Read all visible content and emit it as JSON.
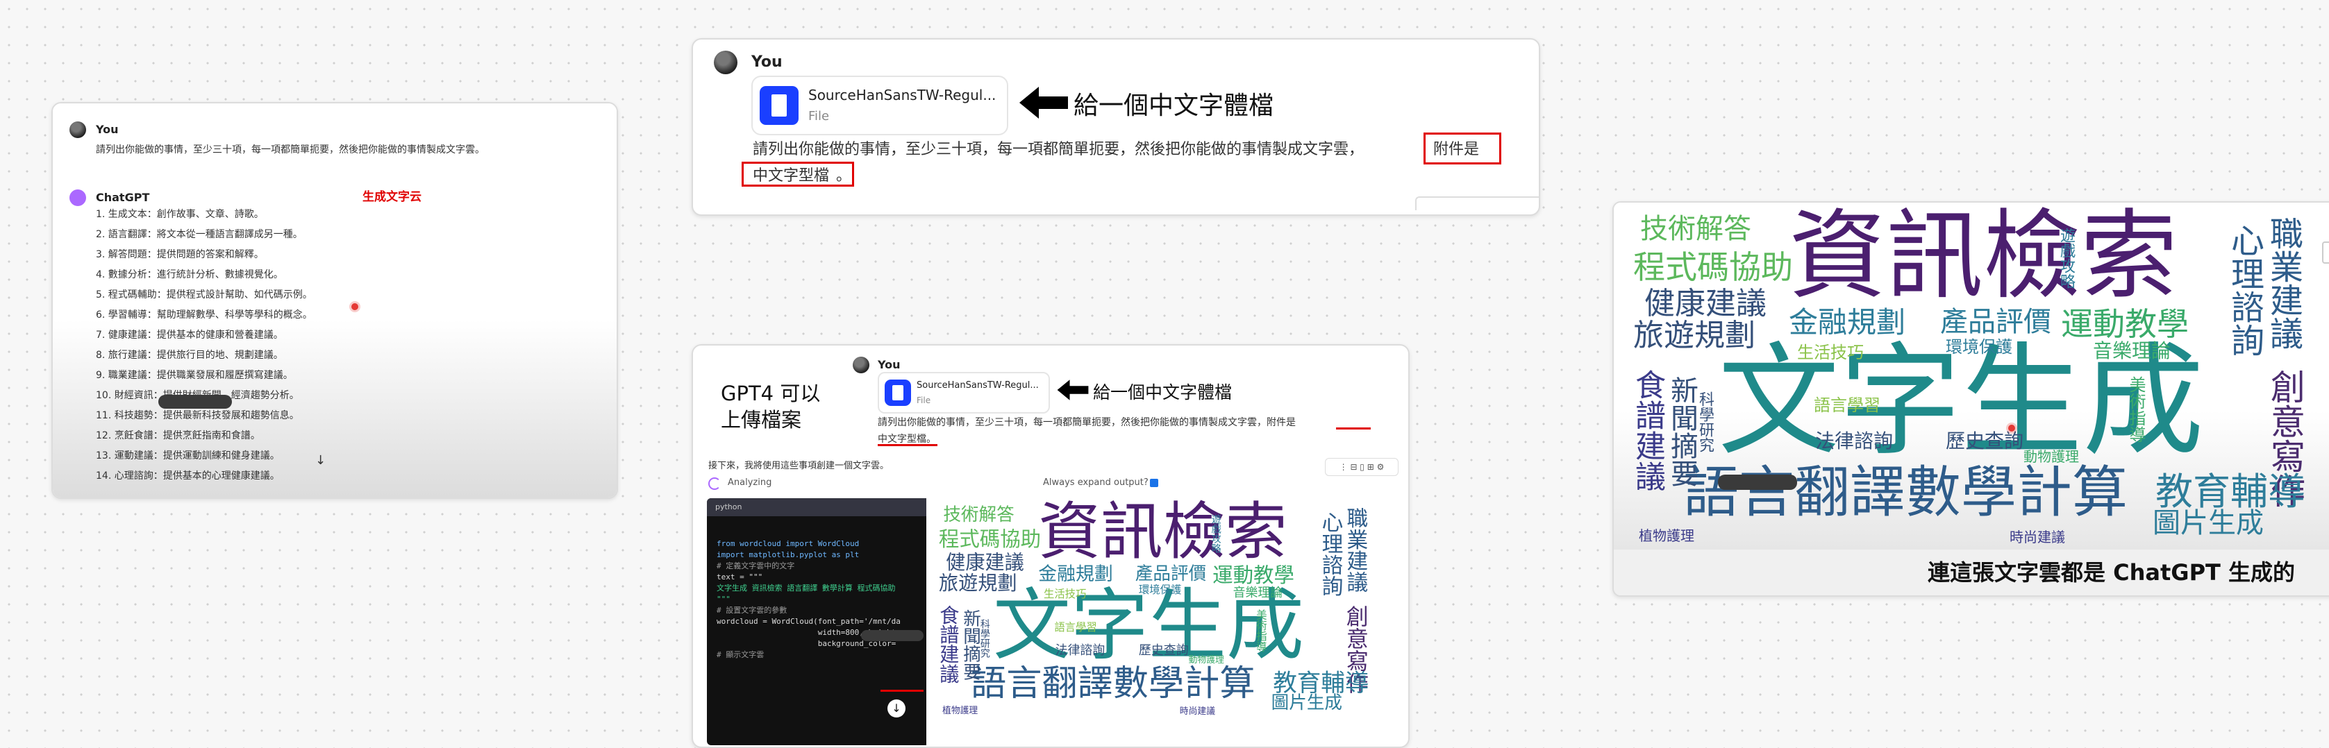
{
  "card1": {
    "user_name": "You",
    "user_prompt": "請列出你能做的事情，至少三十項，每一項都簡單扼要，然後把你能做的事情製成文字雲。",
    "assistant_name": "ChatGPT",
    "red_label": "生成文字云",
    "items": [
      "1. 生成文本：創作故事、文章、詩歌。",
      "2. 語言翻譯：將文本從一種語言翻譯成另一種。",
      "3. 解答問題：提供問題的答案和解釋。",
      "4. 數據分析：進行統計分析、數據視覺化。",
      "5. 程式碼輔助：提供程式設計幫助、如代碼示例。",
      "6. 學習輔導：幫助理解數學、科學等學科的概念。",
      "7. 健康建議：提供基本的健康和營養建議。",
      "8. 旅行建議：提供旅行目的地、規劃建議。",
      "9. 職業建議：提供職業發展和履歷撰寫建議。",
      "10. 財經資訊：提供財經新聞、經濟趨勢分析。",
      "11. 科技趨勢：提供最新科技發展和趨勢信息。",
      "12. 烹飪食譜：提供烹飪指南和食譜。",
      "13. 運動建議：提供運動訓練和健身建議。",
      "14. 心理諮詢：提供基本的心理健康建議。"
    ]
  },
  "card2": {
    "user_name": "You",
    "file_name": "SourceHanSansTW-Regul...",
    "file_type": "File",
    "annotation": "給一個中文字體檔",
    "prompt_line1": "請列出你能做的事情，至少三十項，每一項都簡單扼要，然後把你能做的事情製成文字雲，",
    "prompt_highlight1": "附件是",
    "prompt_highlight2": "中文字型檔",
    "prompt_end": "。"
  },
  "card3": {
    "title_line1": "GPT4 可以",
    "title_line2": "上傳檔案",
    "user_name": "You",
    "file_name": "SourceHanSansTW-Regul...",
    "file_type": "File",
    "annotation": "給一個中文字體檔",
    "prompt_line1": "請列出你能做的事情，至少三十項，每一項都簡單扼要，然後把你能做的事情製成文字雲，附件是",
    "prompt_line2": "中文字型檔。",
    "reply_text": "接下來，我將使用這些事項創建一個文字雲。",
    "analyzing_label": "Analyzing",
    "expand_label": "Always expand output?",
    "code_lang": "python",
    "code_lines": [
      "from wordcloud import WordCloud",
      "import matplotlib.pyplot as plt",
      "",
      "# 定義文字雲中的文字",
      "text = \"\"\"",
      "文字生成 資訊檢索 語言翻譯 數學計算 程式碼協助",
      "\"\"\"",
      "",
      "# 設置文字雲的參數",
      "wordcloud = WordCloud(font_path='/mnt/da",
      "                      width=800, height",
      "                      background_color=",
      "",
      "# 顯示文字雲"
    ]
  },
  "card4": {
    "caption": "連這張文字雲都是 ChatGPT 生成的"
  },
  "wordcloud": {
    "words": [
      {
        "text": "資訊檢索",
        "color": "#4b1f6f"
      },
      {
        "text": "文字生成",
        "color": "#1f8a8a"
      },
      {
        "text": "語言翻譯數學計算",
        "color": "#2e5c8a"
      },
      {
        "text": "技術解答",
        "color": "#5cb85c"
      },
      {
        "text": "程式碼協助",
        "color": "#5cb85c"
      },
      {
        "text": "健康建議",
        "color": "#35507a"
      },
      {
        "text": "旅遊規劃",
        "color": "#35507a"
      },
      {
        "text": "金融規劃",
        "color": "#2e7d9a"
      },
      {
        "text": "產品評價",
        "color": "#2e7d9a"
      },
      {
        "text": "運動教學",
        "color": "#3aaa6a"
      },
      {
        "text": "心理諮詢",
        "color": "#2e5c8a"
      },
      {
        "text": "職業建議",
        "color": "#2e5c8a"
      },
      {
        "text": "創意寫作",
        "color": "#4b2c6f"
      },
      {
        "text": "教育輔導",
        "color": "#2e7d9a"
      },
      {
        "text": "圖片生成",
        "color": "#2e7d9a"
      },
      {
        "text": "食譜建議",
        "color": "#3b3b8a"
      },
      {
        "text": "新聞摘要",
        "color": "#35507a"
      },
      {
        "text": "法律諮詢",
        "color": "#35507a"
      },
      {
        "text": "歷史查詢",
        "color": "#35507a"
      },
      {
        "text": "語言學習",
        "color": "#8bc34a"
      },
      {
        "text": "生活技巧",
        "color": "#8bc34a"
      },
      {
        "text": "環境保護",
        "color": "#2e7d9a"
      },
      {
        "text": "音樂理論",
        "color": "#3aaa6a"
      },
      {
        "text": "科學研究",
        "color": "#35507a"
      },
      {
        "text": "美術指導",
        "color": "#3aaa6a"
      },
      {
        "text": "動物護理",
        "color": "#3aaa6a"
      },
      {
        "text": "時尚建議",
        "color": "#3b3b8a"
      },
      {
        "text": "植物護理",
        "color": "#3b3b8a"
      },
      {
        "text": "遊戲攻略",
        "color": "#2e7d9a"
      }
    ]
  },
  "colors": {
    "accent_red": "#e00000",
    "file_blue": "#1a3fff",
    "gpt_purple": "#ab68ff"
  }
}
